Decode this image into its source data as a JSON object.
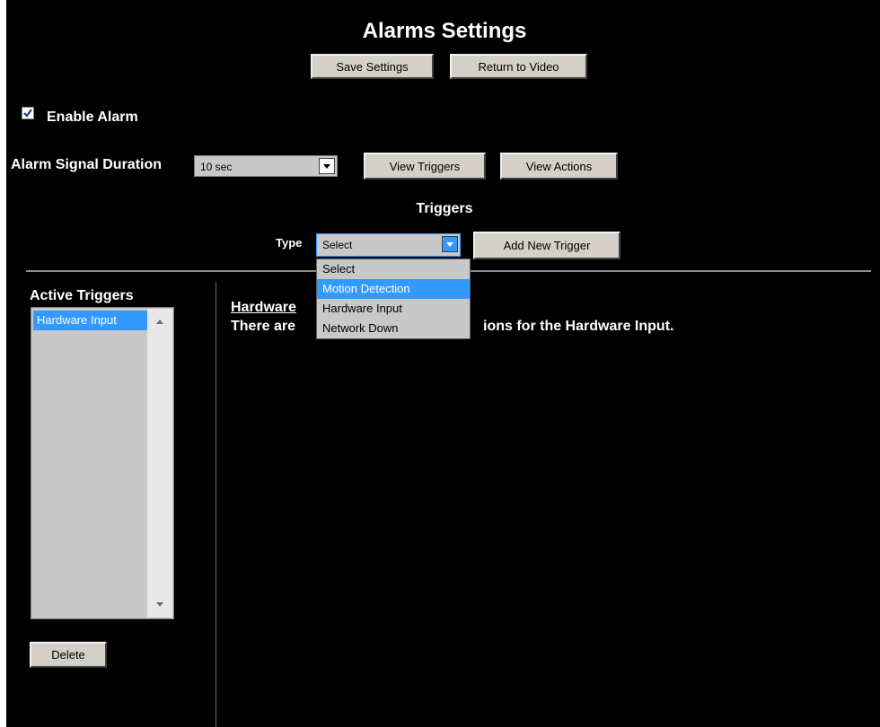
{
  "page": {
    "title": "Alarms Settings",
    "save_label": "Save Settings",
    "return_label": "Return to Video"
  },
  "enable": {
    "label": "Enable Alarm",
    "checked": true
  },
  "duration": {
    "label": "Alarm Signal Duration",
    "value": "10 sec",
    "view_triggers_label": "View Triggers",
    "view_actions_label": "View Actions"
  },
  "triggers": {
    "heading": "Triggers",
    "type_label": "Type",
    "type_value": "Select",
    "add_label": "Add New Trigger",
    "options": [
      "Select",
      "Motion Detection",
      "Hardware Input",
      "Network Down"
    ],
    "highlighted_option": "Motion Detection"
  },
  "active_triggers": {
    "heading": "Active Triggers",
    "items": [
      "Hardware Input"
    ],
    "delete_label": "Delete"
  },
  "detail": {
    "heading_visible": "Hardware",
    "message_left": "There are",
    "message_right": "ions for the Hardware Input."
  },
  "colors": {
    "background": "#000000",
    "button": "#d4d0c8",
    "highlight": "#3399ff"
  }
}
